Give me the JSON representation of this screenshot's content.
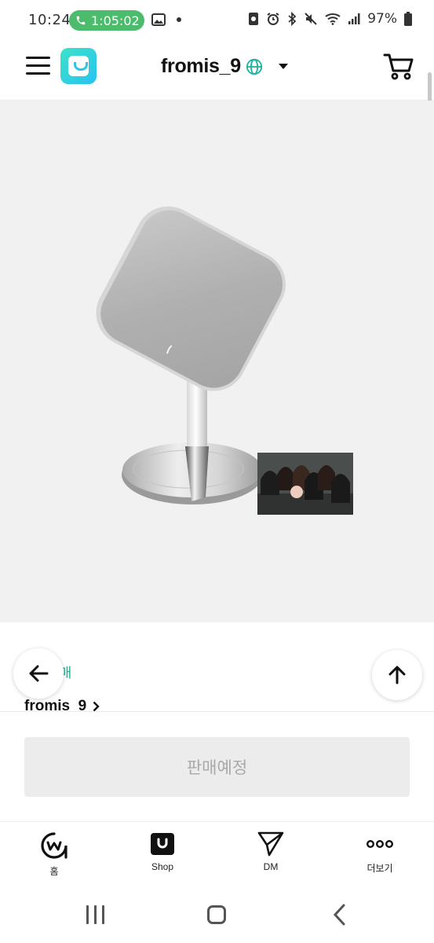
{
  "status_bar": {
    "time": "10:24",
    "call_timer": "1:05:02",
    "battery_text": "97%"
  },
  "header": {
    "artist_name": "fromis_9"
  },
  "product": {
    "sale_label": "판매",
    "artist_link": "fromis_9"
  },
  "purchase": {
    "button_label": "판매예정"
  },
  "tabbar": {
    "items": [
      {
        "label": "홈",
        "icon": "home-w-icon"
      },
      {
        "label": "Shop",
        "icon": "shop-bag-icon"
      },
      {
        "label": "DM",
        "icon": "send-icon"
      },
      {
        "label": "더보기",
        "icon": "more-dots-icon"
      }
    ]
  },
  "colors": {
    "accent_green": "#1aae8a",
    "call_pill": "#4cbb6c",
    "logo_start": "#3ee2c8",
    "logo_end": "#27c3f0",
    "disabled_button": "#ececec"
  }
}
